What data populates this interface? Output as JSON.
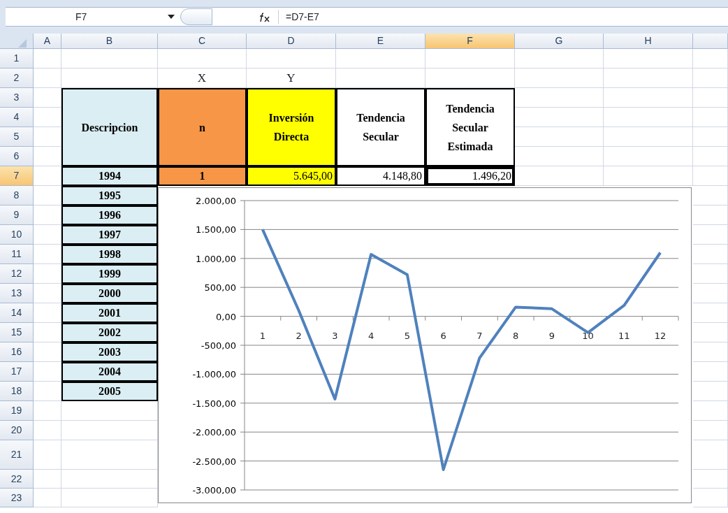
{
  "formula_bar": {
    "name_box": "F7",
    "formula": "=D7-E7"
  },
  "column_headers": [
    {
      "label": "A",
      "selected": false
    },
    {
      "label": "B",
      "selected": false
    },
    {
      "label": "C",
      "selected": false
    },
    {
      "label": "D",
      "selected": false
    },
    {
      "label": "E",
      "selected": false
    },
    {
      "label": "F",
      "selected": true
    },
    {
      "label": "G",
      "selected": false
    },
    {
      "label": "H",
      "selected": false
    }
  ],
  "row_headers": [
    {
      "label": "1",
      "selected": false
    },
    {
      "label": "2",
      "selected": false
    },
    {
      "label": "3",
      "selected": false
    },
    {
      "label": "4",
      "selected": false
    },
    {
      "label": "5",
      "selected": false
    },
    {
      "label": "6",
      "selected": false
    },
    {
      "label": "7",
      "selected": true
    },
    {
      "label": "8",
      "selected": false
    },
    {
      "label": "9",
      "selected": false
    },
    {
      "label": "10",
      "selected": false
    },
    {
      "label": "11",
      "selected": false
    },
    {
      "label": "12",
      "selected": false
    },
    {
      "label": "13",
      "selected": false
    },
    {
      "label": "14",
      "selected": false
    },
    {
      "label": "15",
      "selected": false
    },
    {
      "label": "16",
      "selected": false
    },
    {
      "label": "17",
      "selected": false
    },
    {
      "label": "18",
      "selected": false
    },
    {
      "label": "19",
      "selected": false
    },
    {
      "label": "20",
      "selected": false
    },
    {
      "label": "21",
      "selected": false
    },
    {
      "label": "22",
      "selected": false
    },
    {
      "label": "23",
      "selected": false
    }
  ],
  "axis_labels": [
    "X",
    "Y"
  ],
  "table": {
    "columns": [
      {
        "label": "Descripcion",
        "color": "#daeef3"
      },
      {
        "label": "n",
        "color": "#f79646"
      },
      {
        "label": "Inversión Directa",
        "color": "#ffff00"
      },
      {
        "label": "Tendencia Secular",
        "color": "#ffffff"
      },
      {
        "label": "Tendencia Secular Estimada",
        "color": "#ffffff"
      }
    ],
    "rows": [
      {
        "cells": [
          "1994",
          "1",
          "5.645,00",
          "4.148,80",
          "1.496,20"
        ]
      },
      {
        "cells": [
          "1995"
        ]
      },
      {
        "cells": [
          "1996"
        ]
      },
      {
        "cells": [
          "1997"
        ]
      },
      {
        "cells": [
          "1998"
        ]
      },
      {
        "cells": [
          "1999"
        ]
      },
      {
        "cells": [
          "2000"
        ]
      },
      {
        "cells": [
          "2001"
        ]
      },
      {
        "cells": [
          "2002"
        ]
      },
      {
        "cells": [
          "2003"
        ]
      },
      {
        "cells": [
          "2004"
        ]
      },
      {
        "cells": [
          "2005"
        ]
      }
    ]
  },
  "chart": {
    "chart_data": {
      "type": "line",
      "categories": [
        1,
        2,
        3,
        4,
        5,
        6,
        7,
        8,
        9,
        10,
        11,
        12
      ],
      "grid": true,
      "series": [
        {
          "color": "#4f81bd",
          "values": [
            1500,
            100,
            -1430,
            1070,
            720,
            -2650,
            -720,
            160,
            130,
            -280,
            190,
            1100
          ]
        }
      ],
      "ylim": [
        -3000,
        2000
      ],
      "yticks": [
        {
          "value": 2000,
          "label": "2.000,00"
        },
        {
          "value": 1500,
          "label": "1.500,00"
        },
        {
          "value": 1000,
          "label": "1.000,00"
        },
        {
          "value": 500,
          "label": "500,00"
        },
        {
          "value": 0,
          "label": "0,00"
        },
        {
          "value": -500,
          "label": "-500,00"
        },
        {
          "value": -1000,
          "label": "-1.000,00"
        },
        {
          "value": -1500,
          "label": "-1.500,00"
        },
        {
          "value": -2000,
          "label": "-2.000,00"
        },
        {
          "value": -2500,
          "label": "-2.500,00"
        },
        {
          "value": -3000,
          "label": "-3.000,00"
        }
      ]
    }
  }
}
